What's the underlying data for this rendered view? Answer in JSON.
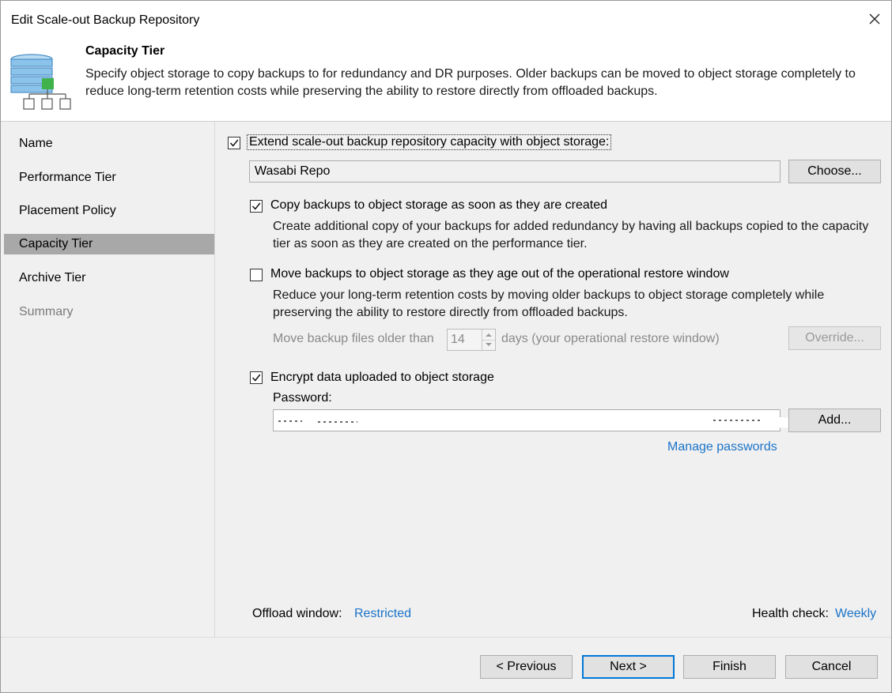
{
  "window": {
    "title": "Edit Scale-out Backup Repository",
    "close_icon": "close-icon"
  },
  "header": {
    "title": "Capacity Tier",
    "description": "Specify object storage to copy backups to for redundancy and DR purposes. Older backups can be moved to object storage completely to reduce long-term retention costs while preserving the ability to restore directly from offloaded backups.",
    "icon": "database-hierarchy-icon"
  },
  "nav": {
    "items": [
      {
        "label": "Name",
        "state": "normal"
      },
      {
        "label": "Performance Tier",
        "state": "normal"
      },
      {
        "label": "Placement Policy",
        "state": "normal"
      },
      {
        "label": "Capacity Tier",
        "state": "active"
      },
      {
        "label": "Archive Tier",
        "state": "normal"
      },
      {
        "label": "Summary",
        "state": "disabled"
      }
    ]
  },
  "capacity": {
    "extend_label": "Extend scale-out backup repository capacity with object storage:",
    "extend_checked": true,
    "repo_value": "Wasabi Repo",
    "choose_label": "Choose...",
    "copy": {
      "label": "Copy backups to object storage as soon as they are created",
      "checked": true,
      "desc": "Create additional copy of your backups for added redundancy by having all backups copied to the capacity tier as soon as they are created on the performance tier."
    },
    "move": {
      "label": "Move backups to object storage as they age out of the operational restore window",
      "checked": false,
      "desc": "Reduce your long-term retention costs by moving older backups to object storage completely while preserving the ability to restore directly from offloaded backups.",
      "older_than_prefix": "Move backup files older than",
      "older_than_value": "14",
      "older_than_suffix": "days (your operational restore window)",
      "override_label": "Override..."
    },
    "encrypt": {
      "label": "Encrypt data uploaded to object storage",
      "checked": true,
      "password_label": "Password:",
      "add_label": "Add...",
      "manage_passwords": "Manage passwords"
    },
    "offload_label": "Offload window:",
    "offload_value": "Restricted",
    "health_label": "Health check:",
    "health_value": "Weekly"
  },
  "footer": {
    "previous_label": "< Previous",
    "next_label": "Next >",
    "finish_label": "Finish",
    "cancel_label": "Cancel"
  },
  "colors": {
    "link": "#1a73c8",
    "nav_active": "#a8a8a8",
    "panel_bg": "#f0f0f0",
    "default_button_border": "#0078d7"
  }
}
